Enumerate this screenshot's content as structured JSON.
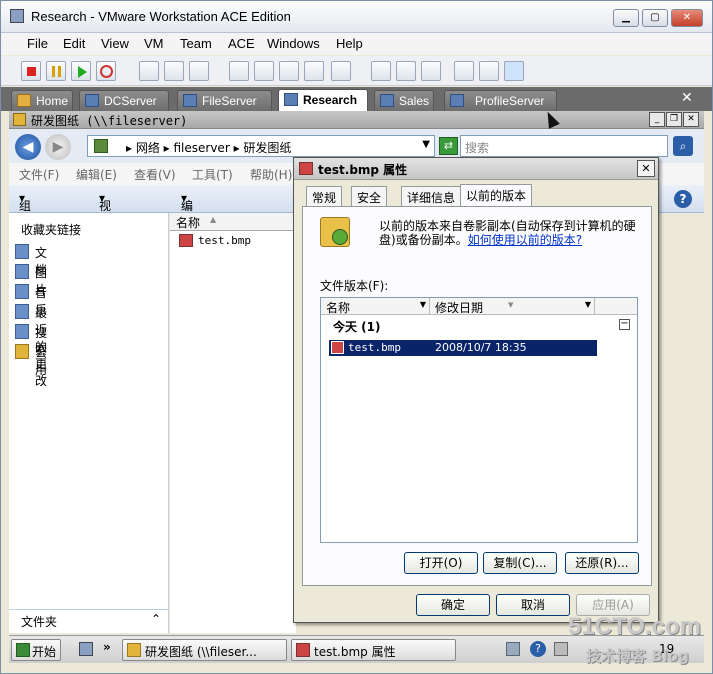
{
  "window": {
    "title": "Research - VMware Workstation ACE Edition"
  },
  "menu": [
    "File",
    "Edit",
    "View",
    "VM",
    "Team",
    "ACE",
    "Windows",
    "Help"
  ],
  "tabs": [
    {
      "label": "Home",
      "active": false
    },
    {
      "label": "DCServer",
      "active": false
    },
    {
      "label": "FileServer",
      "active": false
    },
    {
      "label": "Research",
      "active": true
    },
    {
      "label": "Sales",
      "active": false
    },
    {
      "label": "ProfileServer",
      "active": false
    }
  ],
  "guest": {
    "title": "研发图纸 (\\\\fileserver)",
    "address": "▸ 网络 ▸ fileserver ▸ 研发图纸",
    "search_placeholder": "搜索",
    "menu": [
      "文件(F)",
      "编辑(E)",
      "查看(V)",
      "工具(T)",
      "帮助(H)"
    ],
    "commands": [
      "组织",
      "视图",
      "编辑"
    ],
    "favorites_header": "收藏夹链接",
    "favorites": [
      "文档",
      "图片",
      "音乐",
      "最近的更改",
      "搜索",
      "公用"
    ],
    "folders_label": "文件夹",
    "column_name": "名称",
    "files": [
      "test.bmp"
    ]
  },
  "dialog": {
    "title": "test.bmp 属性",
    "tabs": [
      "常规",
      "安全",
      "详细信息",
      "以前的版本"
    ],
    "info_text": "以前的版本来自卷影副本(自动保存到计算机的硬盘)或备份副本。",
    "info_link": "如何使用以前的版本?",
    "versions_label": "文件版本(F):",
    "col_name": "名称",
    "col_date": "修改日期",
    "group": "今天 (1)",
    "rows": [
      {
        "name": "test.bmp",
        "date": "2008/10/7 18:35"
      }
    ],
    "btn_open": "打开(O)",
    "btn_copy": "复制(C)...",
    "btn_restore": "还原(R)...",
    "btn_ok": "确定",
    "btn_cancel": "取消",
    "btn_apply": "应用(A)"
  },
  "taskbar": {
    "start": "开始",
    "tasks": [
      "研发图纸 (\\\\fileser...",
      "test.bmp 属性"
    ],
    "clock": "19"
  },
  "watermark": {
    "line1": "51CTO.com",
    "line2": "技术博客 Blog"
  },
  "colors": {
    "accent": "#0a246a",
    "selection": "#0a246a",
    "tab_bar": "#6b6b6b"
  }
}
